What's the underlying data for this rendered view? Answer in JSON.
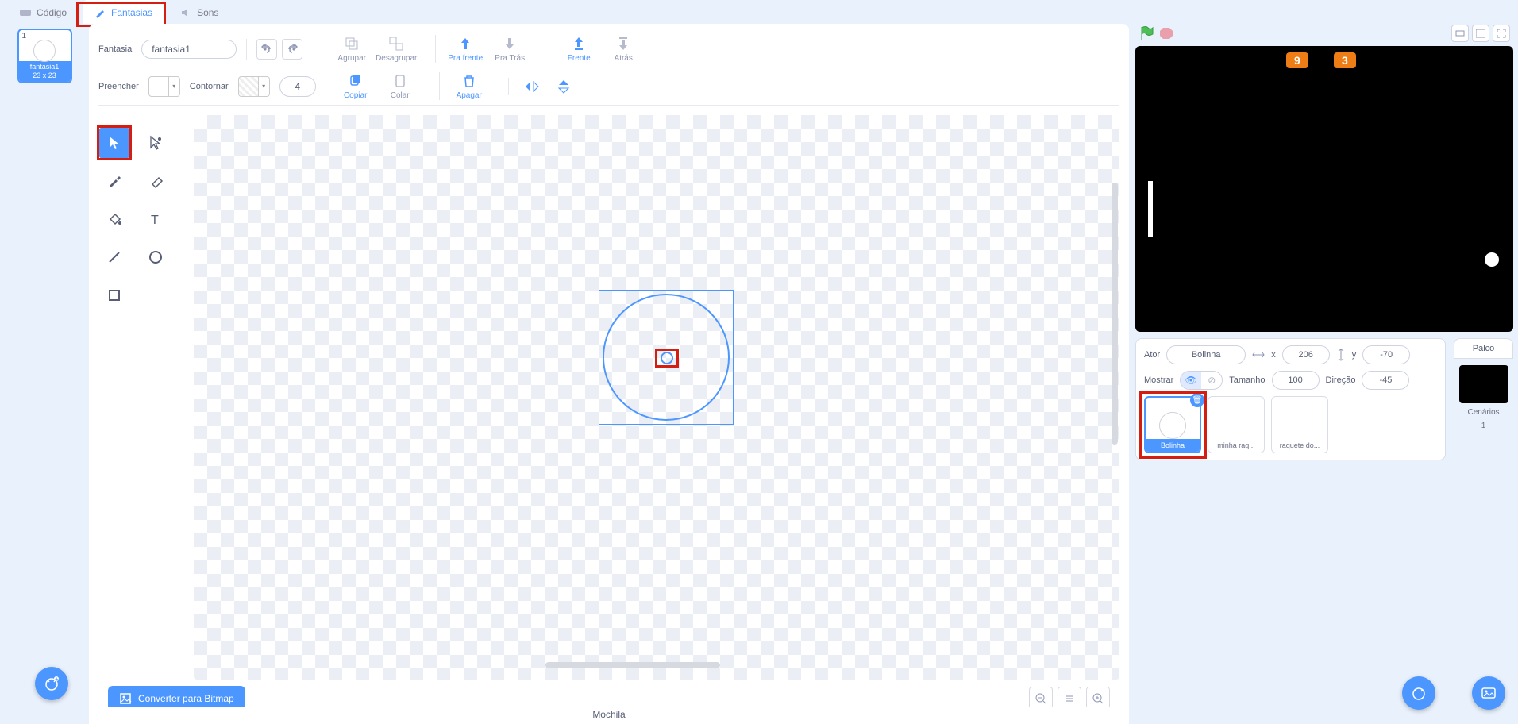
{
  "tabs": {
    "code": "Código",
    "costumes": "Fantasias",
    "sounds": "Sons"
  },
  "costume_thumb": {
    "index": "1",
    "name": "fantasia1",
    "dims": "23 x 23"
  },
  "toolbar": {
    "costume_label": "Fantasia",
    "costume_name": "fantasia1",
    "group": "Agrupar",
    "ungroup": "Desagrupar",
    "forward": "Pra frente",
    "backward": "Pra Trás",
    "front": "Frente",
    "back": "Atrás",
    "fill": "Preencher",
    "outline": "Contornar",
    "outline_width": "4",
    "copy": "Copiar",
    "paste": "Colar",
    "delete": "Apagar",
    "flip_h": "",
    "flip_v": ""
  },
  "convert_btn": "Converter para Bitmap",
  "backpack": "Mochila",
  "stage": {
    "score_left": "9",
    "score_right": "3"
  },
  "sprite_info": {
    "actor_label": "Ator",
    "actor_name": "Bolinha",
    "x_label": "x",
    "x_val": "206",
    "y_label": "y",
    "y_val": "-70",
    "show_label": "Mostrar",
    "size_label": "Tamanho",
    "size_val": "100",
    "dir_label": "Direção",
    "dir_val": "-45"
  },
  "sprites": [
    {
      "name": "Bolinha",
      "selected": true
    },
    {
      "name": "minha raq...",
      "selected": false
    },
    {
      "name": "raquete do...",
      "selected": false
    }
  ],
  "stage_panel": {
    "title": "Palco",
    "backdrops_label": "Cenários",
    "backdrops_count": "1"
  }
}
